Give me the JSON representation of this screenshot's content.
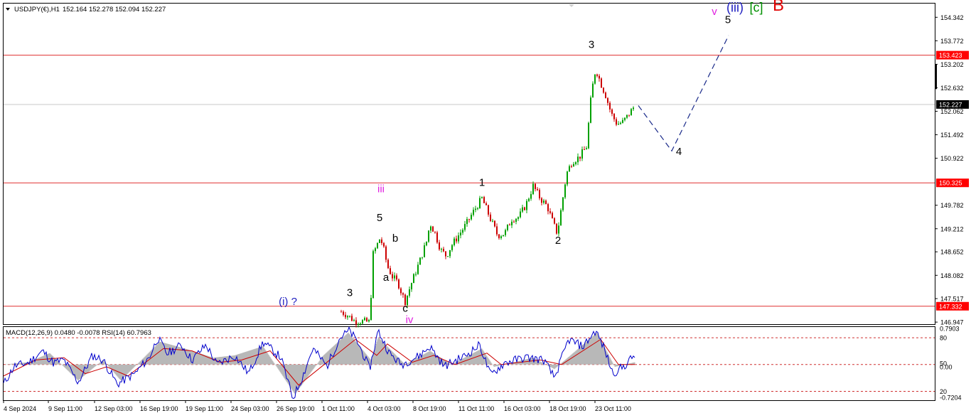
{
  "header": {
    "symbol_label": "USDJPY(€),H1",
    "ohlc": "152.164 152.278 152.094 152.227",
    "menu_icon": "triangle-down-icon"
  },
  "indicator_header": "MACD(12,26,9) 0.0480 -0.0078 RSI(14) 60.7963",
  "colors": {
    "bull_candle": "#00a000",
    "bear_candle": "#cc0000",
    "level_line": "#e03030",
    "price_tag_bg": "#ff0000",
    "current_price_tag_bg": "#000000",
    "wave_black": "#000000",
    "wave_magenta": "#e020e0",
    "wave_blue": "#2020c0",
    "wave_green": "#009000",
    "wave_red": "#e00000",
    "projection": "#1a2a8a",
    "macd_hist": "#b8b8b8",
    "macd_signal": "#cc0000",
    "rsi_line": "#0000cc"
  },
  "chart_data": [
    {
      "type": "line",
      "title": "USDJPY(€),H1",
      "x_ticks": [
        "4 Sep 2024",
        "9 Sep 11:00",
        "12 Sep 03:00",
        "16 Sep 19:00",
        "19 Sep 11:00",
        "24 Sep 03:00",
        "26 Sep 19:00",
        "1 Oct 11:00",
        "4 Oct 03:00",
        "8 Oct 19:00",
        "11 Oct 11:00",
        "16 Oct 03:00",
        "18 Oct 19:00",
        "23 Oct 11:00"
      ],
      "y_ticks": [
        154.342,
        153.772,
        153.202,
        152.632,
        152.062,
        151.492,
        150.922,
        149.782,
        149.212,
        148.652,
        148.082,
        147.517,
        146.947
      ],
      "ylim": [
        146.897,
        154.675
      ],
      "price_levels": [
        153.423,
        150.325,
        147.332
      ],
      "current_price": 152.227,
      "price_path": [
        {
          "bar": 480,
          "price": 147.2
        },
        {
          "bar": 490,
          "price": 147.1
        },
        {
          "bar": 498,
          "price": 146.98
        },
        {
          "bar": 520,
          "price": 146.95
        },
        {
          "bar": 525,
          "price": 148.6
        },
        {
          "bar": 535,
          "price": 149.0
        },
        {
          "bar": 540,
          "price": 148.7
        },
        {
          "bar": 545,
          "price": 148.3
        },
        {
          "bar": 552,
          "price": 148.05
        },
        {
          "bar": 560,
          "price": 147.9
        },
        {
          "bar": 565,
          "price": 147.65
        },
        {
          "bar": 570,
          "price": 147.45
        },
        {
          "bar": 580,
          "price": 147.95
        },
        {
          "bar": 590,
          "price": 148.4
        },
        {
          "bar": 600,
          "price": 148.9
        },
        {
          "bar": 605,
          "price": 149.35
        },
        {
          "bar": 612,
          "price": 149.1
        },
        {
          "bar": 620,
          "price": 148.7
        },
        {
          "bar": 628,
          "price": 148.55
        },
        {
          "bar": 635,
          "price": 148.8
        },
        {
          "bar": 645,
          "price": 149.05
        },
        {
          "bar": 655,
          "price": 149.3
        },
        {
          "bar": 665,
          "price": 149.6
        },
        {
          "bar": 678,
          "price": 149.95
        },
        {
          "bar": 690,
          "price": 149.45
        },
        {
          "bar": 700,
          "price": 149.05
        },
        {
          "bar": 710,
          "price": 149.1
        },
        {
          "bar": 720,
          "price": 149.45
        },
        {
          "bar": 730,
          "price": 149.5
        },
        {
          "bar": 740,
          "price": 149.8
        },
        {
          "bar": 750,
          "price": 150.25
        },
        {
          "bar": 760,
          "price": 149.95
        },
        {
          "bar": 770,
          "price": 149.75
        },
        {
          "bar": 778,
          "price": 149.35
        },
        {
          "bar": 784,
          "price": 149.1
        },
        {
          "bar": 790,
          "price": 149.75
        },
        {
          "bar": 797,
          "price": 150.55
        },
        {
          "bar": 805,
          "price": 150.85
        },
        {
          "bar": 815,
          "price": 150.95
        },
        {
          "bar": 825,
          "price": 151.2
        },
        {
          "bar": 832,
          "price": 152.5
        },
        {
          "bar": 838,
          "price": 153.1
        },
        {
          "bar": 845,
          "price": 152.75
        },
        {
          "bar": 852,
          "price": 152.45
        },
        {
          "bar": 860,
          "price": 152.0
        },
        {
          "bar": 868,
          "price": 151.75
        },
        {
          "bar": 876,
          "price": 151.8
        },
        {
          "bar": 883,
          "price": 151.95
        },
        {
          "bar": 893,
          "price": 152.2
        }
      ],
      "projection": [
        {
          "bar": 898,
          "price": 152.2
        },
        {
          "bar": 945,
          "price": 151.1
        },
        {
          "bar": 1025,
          "price": 153.9
        }
      ],
      "wave_labels": [
        {
          "text": "(i) ?",
          "bar": 405,
          "price": 147.36,
          "color": "blue"
        },
        {
          "text": "3",
          "bar": 492,
          "price": 147.58,
          "color": "black"
        },
        {
          "text": "iii",
          "bar": 536,
          "price": 150.1,
          "color": "magenta"
        },
        {
          "text": "5",
          "bar": 534,
          "price": 149.4,
          "color": "black"
        },
        {
          "text": "b",
          "bar": 556,
          "price": 148.9,
          "color": "black"
        },
        {
          "text": "a",
          "bar": 543,
          "price": 147.95,
          "color": "black"
        },
        {
          "text": "c",
          "bar": 570,
          "price": 147.2,
          "color": "black"
        },
        {
          "text": "iv",
          "bar": 576,
          "price": 146.92,
          "color": "magenta"
        },
        {
          "text": "1",
          "bar": 678,
          "price": 150.25,
          "color": "black"
        },
        {
          "text": "2",
          "bar": 785,
          "price": 148.85,
          "color": "black"
        },
        {
          "text": "3",
          "bar": 832,
          "price": 153.6,
          "color": "black"
        },
        {
          "text": "4",
          "bar": 955,
          "price": 151.0,
          "color": "black"
        },
        {
          "text": "5",
          "bar": 1024,
          "price": 154.2,
          "color": "black"
        },
        {
          "text": "v",
          "bar": 1005,
          "price": 154.4,
          "color": "magenta"
        },
        {
          "text": "(iii)",
          "bar": 1034,
          "price": 154.48,
          "color": "blue"
        },
        {
          "text": "[c]",
          "bar": 1064,
          "price": 154.48,
          "color": "green"
        },
        {
          "text": "B",
          "bar": 1095,
          "price": 154.5,
          "color": "red"
        }
      ]
    },
    {
      "type": "line",
      "title": "MACD(12,26,9) 0.0480 -0.0078 RSI(14) 60.7963",
      "y_ticks": [
        "0.7903",
        "80",
        "0.00",
        "50",
        "20",
        "-0.7204"
      ],
      "rsi_levels": [
        80,
        50,
        20
      ],
      "rsi_path": [
        {
          "bar": 5,
          "value": 28
        },
        {
          "bar": 20,
          "value": 48
        },
        {
          "bar": 40,
          "value": 52
        },
        {
          "bar": 60,
          "value": 65
        },
        {
          "bar": 75,
          "value": 52
        },
        {
          "bar": 90,
          "value": 55
        },
        {
          "bar": 110,
          "value": 30
        },
        {
          "bar": 130,
          "value": 60
        },
        {
          "bar": 145,
          "value": 55
        },
        {
          "bar": 165,
          "value": 28
        },
        {
          "bar": 190,
          "value": 40
        },
        {
          "bar": 210,
          "value": 58
        },
        {
          "bar": 222,
          "value": 80
        },
        {
          "bar": 235,
          "value": 62
        },
        {
          "bar": 255,
          "value": 72
        },
        {
          "bar": 270,
          "value": 55
        },
        {
          "bar": 290,
          "value": 72
        },
        {
          "bar": 305,
          "value": 50
        },
        {
          "bar": 330,
          "value": 60
        },
        {
          "bar": 350,
          "value": 40
        },
        {
          "bar": 370,
          "value": 75
        },
        {
          "bar": 395,
          "value": 58
        },
        {
          "bar": 412,
          "value": 12
        },
        {
          "bar": 425,
          "value": 35
        },
        {
          "bar": 440,
          "value": 68
        },
        {
          "bar": 460,
          "value": 48
        },
        {
          "bar": 478,
          "value": 80
        },
        {
          "bar": 492,
          "value": 88
        },
        {
          "bar": 505,
          "value": 72
        },
        {
          "bar": 520,
          "value": 45
        },
        {
          "bar": 532,
          "value": 88
        },
        {
          "bar": 548,
          "value": 62
        },
        {
          "bar": 565,
          "value": 50
        },
        {
          "bar": 590,
          "value": 60
        },
        {
          "bar": 605,
          "value": 70
        },
        {
          "bar": 625,
          "value": 48
        },
        {
          "bar": 655,
          "value": 60
        },
        {
          "bar": 675,
          "value": 72
        },
        {
          "bar": 690,
          "value": 38
        },
        {
          "bar": 710,
          "value": 52
        },
        {
          "bar": 740,
          "value": 58
        },
        {
          "bar": 765,
          "value": 55
        },
        {
          "bar": 780,
          "value": 35
        },
        {
          "bar": 800,
          "value": 78
        },
        {
          "bar": 820,
          "value": 70
        },
        {
          "bar": 838,
          "value": 88
        },
        {
          "bar": 850,
          "value": 68
        },
        {
          "bar": 862,
          "value": 40
        },
        {
          "bar": 878,
          "value": 48
        },
        {
          "bar": 893,
          "value": 61
        }
      ],
      "macd_hist_path": [
        {
          "bar": 5,
          "value": 0.0
        },
        {
          "bar": 40,
          "value": 0.05
        },
        {
          "bar": 70,
          "value": 0.25
        },
        {
          "bar": 110,
          "value": -0.35
        },
        {
          "bar": 145,
          "value": 0.1
        },
        {
          "bar": 170,
          "value": -0.35
        },
        {
          "bar": 225,
          "value": 0.5
        },
        {
          "bar": 260,
          "value": 0.35
        },
        {
          "bar": 300,
          "value": 0.15
        },
        {
          "bar": 330,
          "value": 0.2
        },
        {
          "bar": 370,
          "value": 0.4
        },
        {
          "bar": 415,
          "value": -0.65
        },
        {
          "bar": 455,
          "value": 0.2
        },
        {
          "bar": 490,
          "value": 0.7
        },
        {
          "bar": 522,
          "value": 0.1
        },
        {
          "bar": 532,
          "value": 0.6
        },
        {
          "bar": 570,
          "value": 0.0
        },
        {
          "bar": 605,
          "value": 0.3
        },
        {
          "bar": 635,
          "value": 0.0
        },
        {
          "bar": 678,
          "value": 0.35
        },
        {
          "bar": 695,
          "value": -0.05
        },
        {
          "bar": 750,
          "value": 0.15
        },
        {
          "bar": 780,
          "value": -0.1
        },
        {
          "bar": 840,
          "value": 0.7
        },
        {
          "bar": 865,
          "value": -0.05
        },
        {
          "bar": 893,
          "value": 0.05
        }
      ],
      "macd_signal_path": [
        {
          "bar": 5,
          "value": -0.25
        },
        {
          "bar": 50,
          "value": 0.1
        },
        {
          "bar": 90,
          "value": 0.15
        },
        {
          "bar": 120,
          "value": -0.2
        },
        {
          "bar": 150,
          "value": -0.05
        },
        {
          "bar": 180,
          "value": -0.25
        },
        {
          "bar": 230,
          "value": 0.35
        },
        {
          "bar": 270,
          "value": 0.3
        },
        {
          "bar": 310,
          "value": 0.05
        },
        {
          "bar": 340,
          "value": 0.1
        },
        {
          "bar": 380,
          "value": 0.3
        },
        {
          "bar": 420,
          "value": -0.45
        },
        {
          "bar": 460,
          "value": 0.05
        },
        {
          "bar": 500,
          "value": 0.55
        },
        {
          "bar": 530,
          "value": 0.2
        },
        {
          "bar": 545,
          "value": 0.45
        },
        {
          "bar": 580,
          "value": 0.05
        },
        {
          "bar": 610,
          "value": 0.2
        },
        {
          "bar": 640,
          "value": 0.0
        },
        {
          "bar": 685,
          "value": 0.25
        },
        {
          "bar": 705,
          "value": 0.0
        },
        {
          "bar": 760,
          "value": 0.1
        },
        {
          "bar": 790,
          "value": 0.0
        },
        {
          "bar": 845,
          "value": 0.55
        },
        {
          "bar": 870,
          "value": 0.0
        },
        {
          "bar": 893,
          "value": 0.0
        }
      ]
    }
  ]
}
